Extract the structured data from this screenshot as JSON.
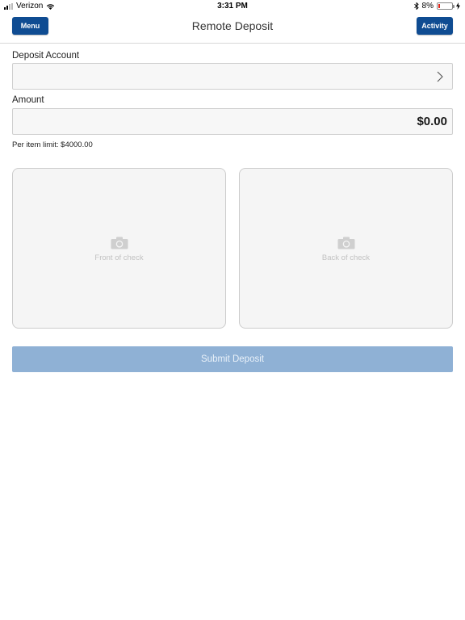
{
  "status_bar": {
    "carrier": "Verizon",
    "time": "3:31 PM",
    "battery": "8%",
    "battery_color": "#e2261b"
  },
  "navbar": {
    "title": "Remote Deposit",
    "menu_label": "Menu",
    "activity_label": "Activity",
    "button_color": "#0f4c92"
  },
  "form": {
    "account_label": "Deposit Account",
    "account_value": "",
    "amount_label": "Amount",
    "amount_value": "$0.00",
    "limit_text": "Per item limit: $4000.00"
  },
  "checks": {
    "front_caption": "Front of check",
    "back_caption": "Back of check",
    "icon": "camera-icon"
  },
  "submit": {
    "label": "Submit Deposit",
    "color": "#8fb1d5"
  }
}
